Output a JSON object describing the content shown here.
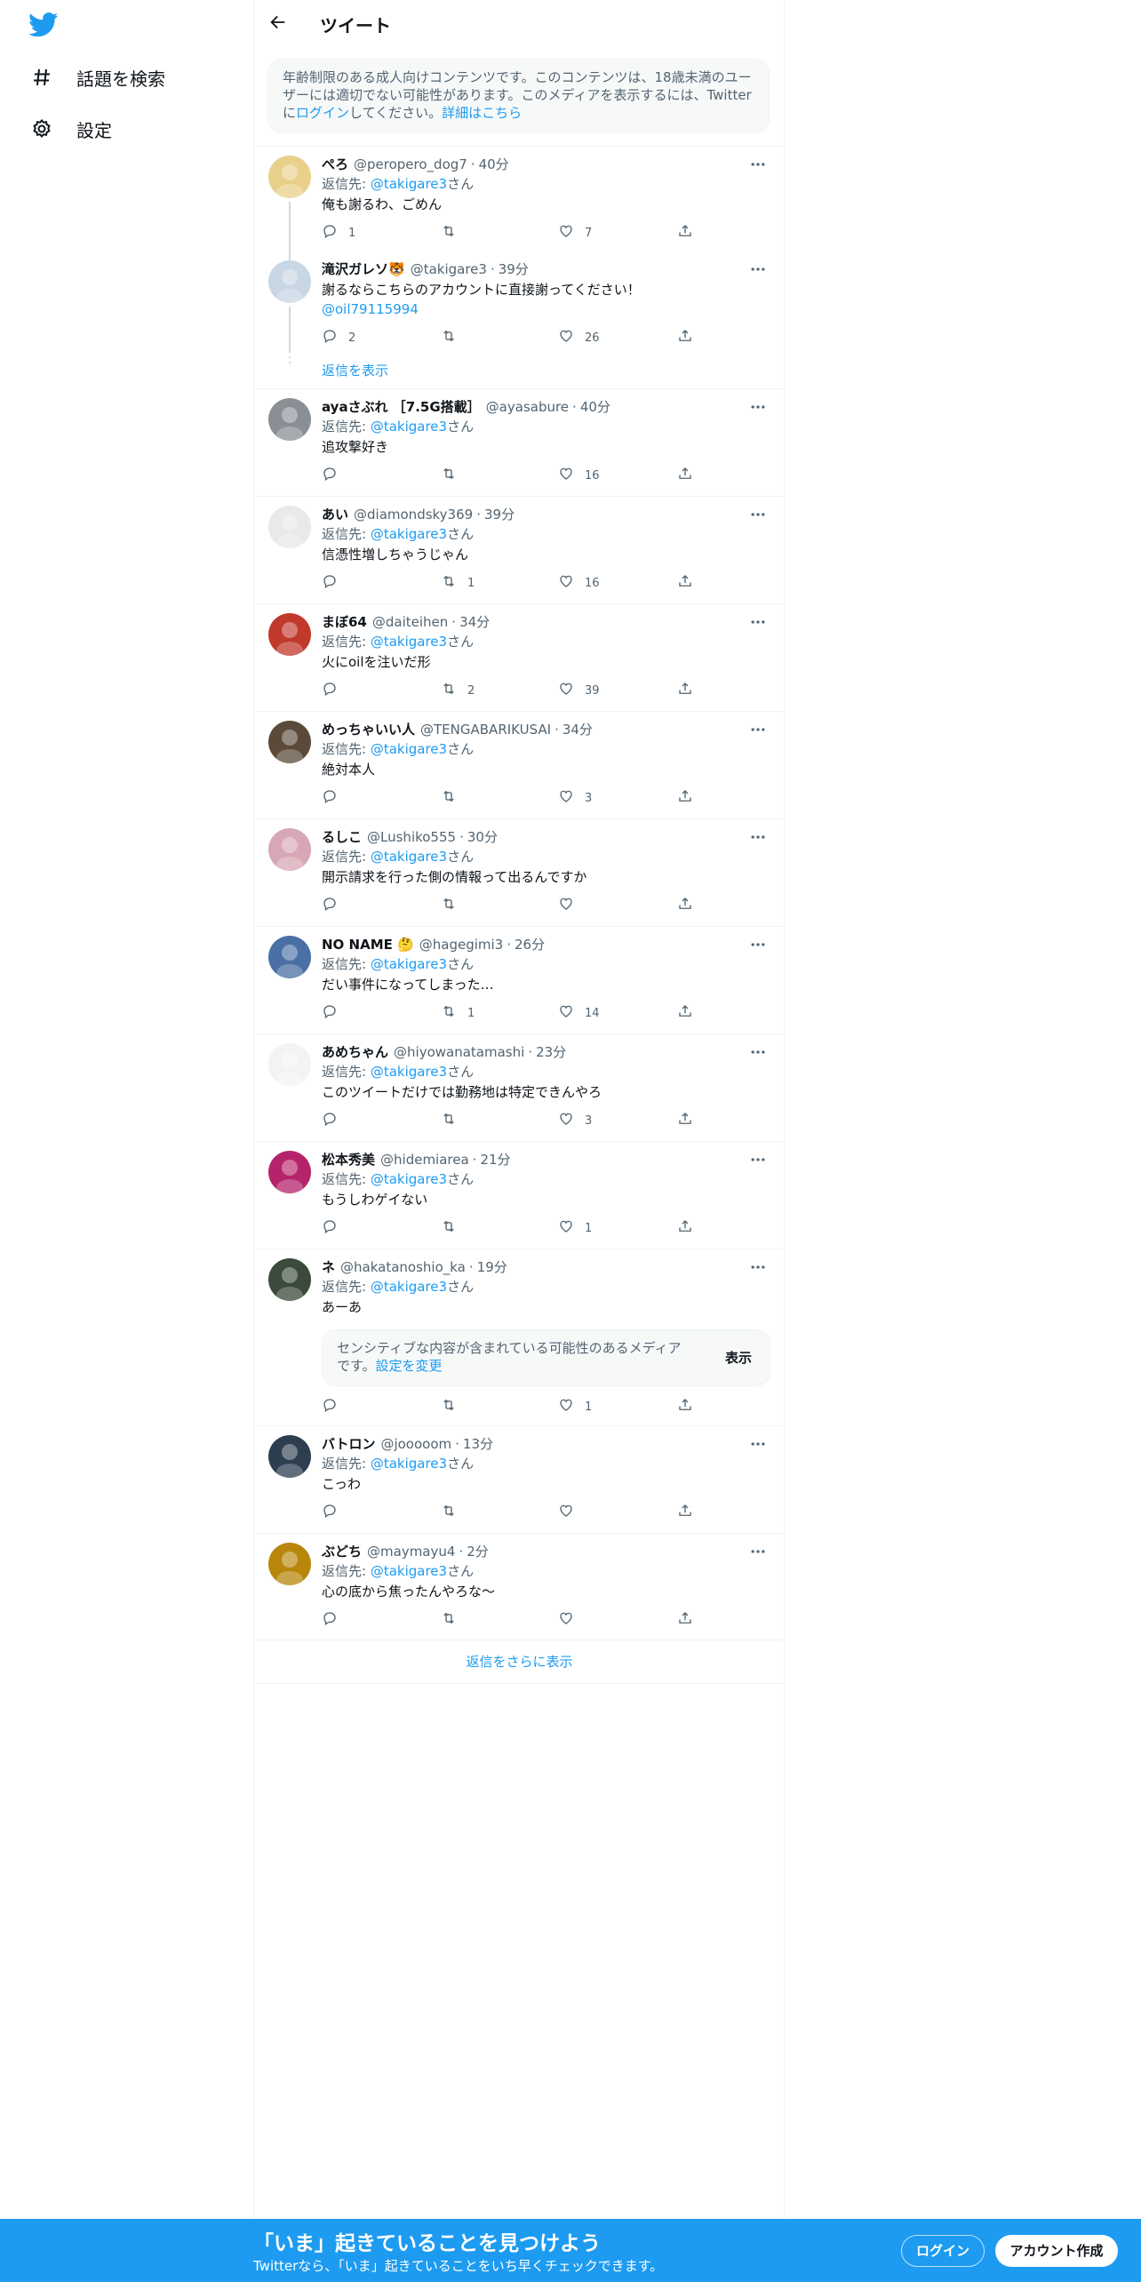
{
  "colors": {
    "accent": "#1d9bf0",
    "text": "#0f1419",
    "muted": "#536471",
    "border": "#eff3f4"
  },
  "sidebar": {
    "logo_icon": "twitter-bird-icon",
    "items": [
      {
        "label": "話題を検索",
        "icon": "hashtag-icon"
      },
      {
        "label": "設定",
        "icon": "gear-icon"
      }
    ]
  },
  "header": {
    "title": "ツイート"
  },
  "notice": {
    "text_before": "年齢制限のある成人向けコンテンツです。このコンテンツは、18歳未満のユーザーには適切でない可能性があります。このメディアを表示するには、Twitterに",
    "login_link": "ログイン",
    "text_after": "してください。",
    "details_link": "詳細はこちら"
  },
  "tweets": [
    {
      "name": "ぺろ",
      "handle": "@peropero_dog7",
      "time": "40分",
      "reply_prefix": "返信先: ",
      "reply_to": "@takigare3",
      "reply_suffix": "さん",
      "text": "俺も謝るわ、ごめん",
      "replies": "1",
      "retweets": "",
      "likes": "7"
    },
    {
      "name": "滝沢ガレソ🐯",
      "handle": "@takigare3",
      "time": "39分",
      "text": "謝るならこちらのアカウントに直接謝ってください！",
      "mention_line": "@oil79115994",
      "replies": "2",
      "retweets": "",
      "likes": "26"
    },
    {
      "name": "ayaさぶれ ［7.5G搭載］",
      "handle": "@ayasabure",
      "time": "40分",
      "reply_prefix": "返信先: ",
      "reply_to": "@takigare3",
      "reply_suffix": "さん",
      "text": "追攻撃好き",
      "replies": "",
      "retweets": "",
      "likes": "16"
    },
    {
      "name": "あい",
      "handle": "@diamondsky369",
      "time": "39分",
      "reply_prefix": "返信先: ",
      "reply_to": "@takigare3",
      "reply_suffix": "さん",
      "text": "信憑性増しちゃうじゃん",
      "replies": "",
      "retweets": "1",
      "likes": "16"
    },
    {
      "name": "まぼ64",
      "handle": "@daiteihen",
      "time": "34分",
      "reply_prefix": "返信先: ",
      "reply_to": "@takigare3",
      "reply_suffix": "さん",
      "text": "火にoilを注いだ形",
      "replies": "",
      "retweets": "2",
      "likes": "39"
    },
    {
      "name": "めっちゃいい人",
      "handle": "@TENGABARIKUSAI",
      "time": "34分",
      "reply_prefix": "返信先: ",
      "reply_to": "@takigare3",
      "reply_suffix": "さん",
      "text": "絶対本人",
      "replies": "",
      "retweets": "",
      "likes": "3"
    },
    {
      "name": "るしこ",
      "handle": "@Lushiko555",
      "time": "30分",
      "reply_prefix": "返信先: ",
      "reply_to": "@takigare3",
      "reply_suffix": "さん",
      "text": "開示請求を行った側の情報って出るんですか",
      "replies": "",
      "retweets": "",
      "likes": ""
    },
    {
      "name": "NO NAME 🤔",
      "handle": "@hagegimi3",
      "time": "26分",
      "reply_prefix": "返信先: ",
      "reply_to": "@takigare3",
      "reply_suffix": "さん",
      "text": "だい事件になってしまった…",
      "replies": "",
      "retweets": "1",
      "likes": "14"
    },
    {
      "name": "あめちゃん",
      "handle": "@hiyowanatamashi",
      "time": "23分",
      "reply_prefix": "返信先: ",
      "reply_to": "@takigare3",
      "reply_suffix": "さん",
      "text": "このツイートだけでは勤務地は特定できんやろ",
      "replies": "",
      "retweets": "",
      "likes": "3"
    },
    {
      "name": "松本秀美",
      "handle": "@hidemiarea",
      "time": "21分",
      "reply_prefix": "返信先: ",
      "reply_to": "@takigare3",
      "reply_suffix": "さん",
      "text": "もうしわゲイない",
      "replies": "",
      "retweets": "",
      "likes": "1"
    },
    {
      "name": "ネ",
      "handle": "@hakatanoshio_ka",
      "time": "19分",
      "reply_prefix": "返信先: ",
      "reply_to": "@takigare3",
      "reply_suffix": "さん",
      "text": "あーあ",
      "replies": "",
      "retweets": "",
      "likes": "1",
      "sensitive": {
        "text": "センシティブな内容が含まれている可能性のあるメディアです。",
        "link": "設定を変更",
        "button": "表示"
      }
    },
    {
      "name": "バトロン",
      "handle": "@jooooom",
      "time": "13分",
      "reply_prefix": "返信先: ",
      "reply_to": "@takigare3",
      "reply_suffix": "さん",
      "text": "こっわ",
      "replies": "",
      "retweets": "",
      "likes": ""
    },
    {
      "name": "ぶどち",
      "handle": "@maymayu4",
      "time": "2分",
      "reply_prefix": "返信先: ",
      "reply_to": "@takigare3",
      "reply_suffix": "さん",
      "text": "心の底から焦ったんやろな～",
      "replies": "",
      "retweets": "",
      "likes": ""
    }
  ],
  "thread_show_replies": "返信を表示",
  "more_replies": "返信をさらに表示",
  "bottom_bar": {
    "title": "「いま」起きていることを見つけよう",
    "subtitle": "Twitterなら、「いま」起きていることをいち早くチェックできます。",
    "login": "ログイン",
    "signup": "アカウント作成"
  }
}
